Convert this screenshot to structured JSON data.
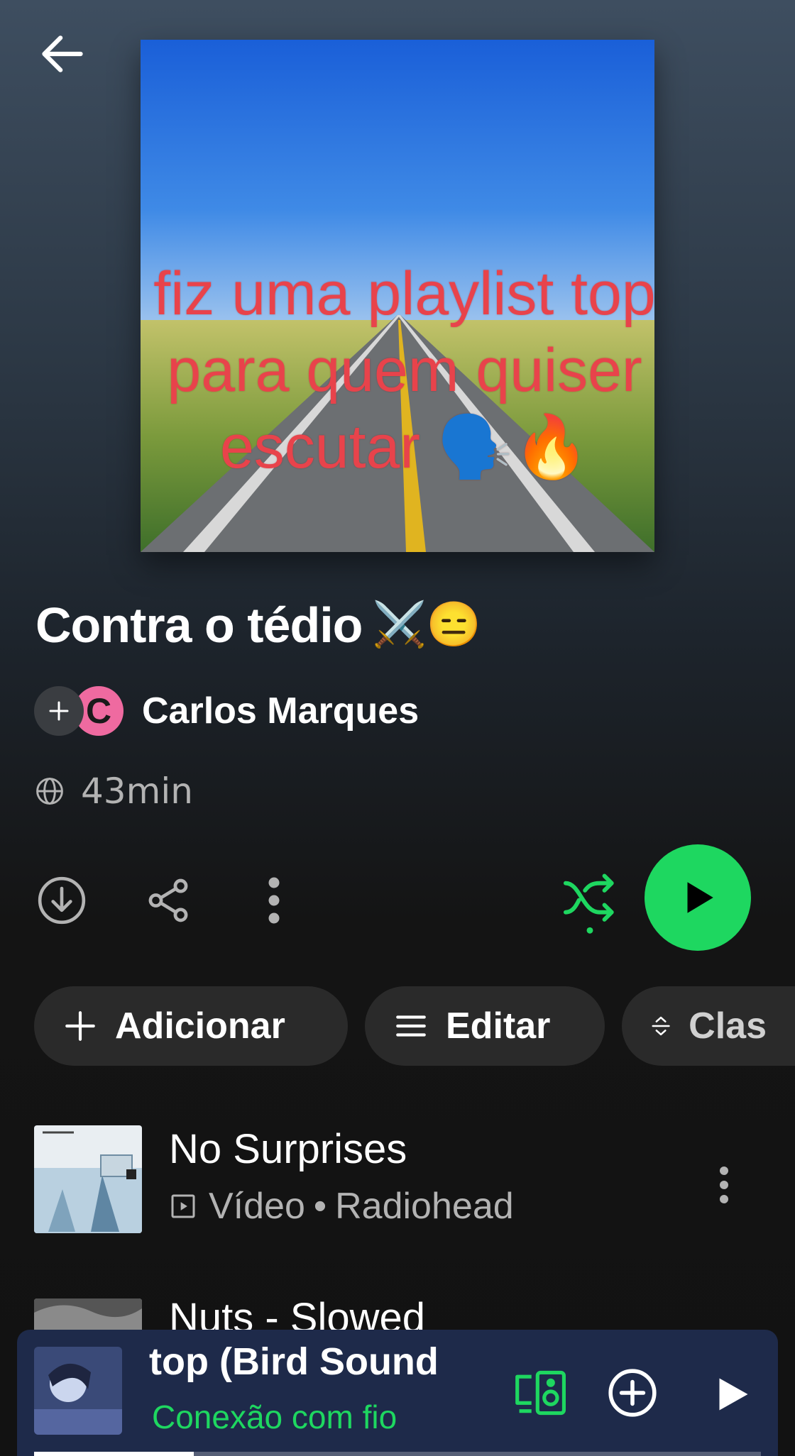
{
  "header": {
    "back_icon": "arrow-left-icon"
  },
  "cover": {
    "caption_lines": [
      "fiz uma playlist top",
      "para quem quiser",
      "escutar 🗣️🔥"
    ],
    "caption_color": "#e8434b"
  },
  "playlist": {
    "title": "Contra o tédio",
    "title_emojis": "⚔️😑",
    "owner_initial": "C",
    "owner_name": "Carlos Marques",
    "duration": "43min"
  },
  "actions": {
    "download_icon": "download-circle-icon",
    "share_icon": "share-icon",
    "more_icon": "more-vertical-icon",
    "shuffle_icon": "shuffle-icon",
    "play_icon": "play-icon",
    "accent": "#1ed760"
  },
  "chips": [
    {
      "label": "Adicionar",
      "icon": "plus-icon"
    },
    {
      "label": "Editar",
      "icon": "list-icon"
    },
    {
      "label": "Clas",
      "icon": "sort-icon"
    }
  ],
  "tracks": [
    {
      "title": "No Surprises",
      "type": "Vídeo",
      "artist": "Radiohead",
      "separator": "•"
    },
    {
      "title": "Nuts - Slowed"
    }
  ],
  "mini_player": {
    "title": "top (Bird Sound",
    "status": "Conexão com fio",
    "progress": 0.22,
    "status_color": "#1ed760"
  }
}
